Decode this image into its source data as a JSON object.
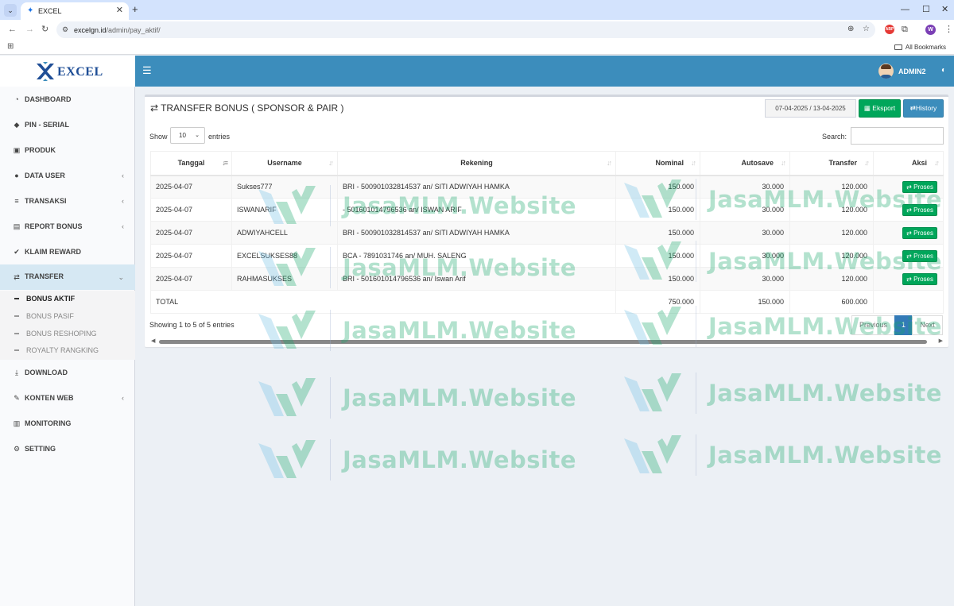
{
  "browser": {
    "tab_title": "EXCEL",
    "url_host": "excelgn.id",
    "url_path": "/admin/pay_aktif/",
    "bookmarks_label": "All Bookmarks",
    "profile_initial": "W",
    "ext_label": "ABP"
  },
  "header": {
    "logo_text": "EXCEL",
    "user_name": "ADMIN2"
  },
  "sidebar": {
    "items": [
      {
        "label": "DASHBOARD",
        "icon": "dashboard-icon"
      },
      {
        "label": "PIN - SERIAL",
        "icon": "tag-icon"
      },
      {
        "label": "PRODUK",
        "icon": "box-icon"
      },
      {
        "label": "DATA USER",
        "icon": "users-icon"
      },
      {
        "label": "TRANSAKSI",
        "icon": "list-icon"
      },
      {
        "label": "REPORT BONUS",
        "icon": "money-icon"
      },
      {
        "label": "KLAIM REWARD",
        "icon": "check-icon"
      },
      {
        "label": "TRANSFER",
        "icon": "exchange-icon"
      },
      {
        "label": "DOWNLOAD",
        "icon": "download-icon"
      },
      {
        "label": "KONTEN WEB",
        "icon": "edit-icon"
      },
      {
        "label": "MONITORING",
        "icon": "bar-chart-icon"
      },
      {
        "label": "SETTING",
        "icon": "cogs-icon"
      }
    ],
    "sub_items": [
      {
        "label": "BONUS AKTIF"
      },
      {
        "label": "BONUS PASIF"
      },
      {
        "label": "BONUS RESHOPING"
      },
      {
        "label": "ROYALTY RANGKING"
      }
    ]
  },
  "main": {
    "title": "TRANSFER BONUS ( SPONSOR & PAIR )",
    "date_range": "07-04-2025 / 13-04-2025",
    "export_label": "Eksport",
    "history_label": "History",
    "show_label": "Show",
    "length_value": "10",
    "entries_label": "entries",
    "search_label": "Search:",
    "columns": [
      "Tanggal",
      "Username",
      "Rekening",
      "Nominal",
      "Autosave",
      "Transfer",
      "Aksi"
    ],
    "rows": [
      {
        "tanggal": "2025-04-07",
        "username": "Sukses777",
        "rekening": "BRI - 500901032814537 an/ SITI ADWIYAH HAMKA",
        "nominal": "150.000",
        "autosave": "30.000",
        "transfer": "120.000",
        "aksi": "Proses"
      },
      {
        "tanggal": "2025-04-07",
        "username": "ISWANARIF",
        "rekening": "- 501601014796536 an/ ISWAN ARIF",
        "nominal": "150.000",
        "autosave": "30.000",
        "transfer": "120.000",
        "aksi": "Proses"
      },
      {
        "tanggal": "2025-04-07",
        "username": "ADWIYAHCELL",
        "rekening": "BRI - 500901032814537 an/ SITI ADWIYAH HAMKA",
        "nominal": "150.000",
        "autosave": "30.000",
        "transfer": "120.000",
        "aksi": "Proses"
      },
      {
        "tanggal": "2025-04-07",
        "username": "EXCELSUKSES88",
        "rekening": "BCA - 7891031746 an/ MUH. SALENG",
        "nominal": "150.000",
        "autosave": "30.000",
        "transfer": "120.000",
        "aksi": "Proses"
      },
      {
        "tanggal": "2025-04-07",
        "username": "RAHMASUKSES",
        "rekening": "BRI - 501601014796536 an/ Iswan Arif",
        "nominal": "150.000",
        "autosave": "30.000",
        "transfer": "120.000",
        "aksi": "Proses"
      }
    ],
    "total": {
      "label": "TOTAL",
      "nominal": "750.000",
      "autosave": "150.000",
      "transfer": "600.000"
    },
    "info": "Showing 1 to 5 of 5 entries",
    "pager": {
      "previous": "Previous",
      "current": "1",
      "next": "Next"
    }
  },
  "watermark": {
    "text": "JasaMLM.Website"
  },
  "colors": {
    "topbar": "#3c8dbc",
    "success": "#00a65a",
    "primary": "#3c8dbc",
    "sidebar_active": "#d6e8f3",
    "watermark": "#16a86a"
  }
}
